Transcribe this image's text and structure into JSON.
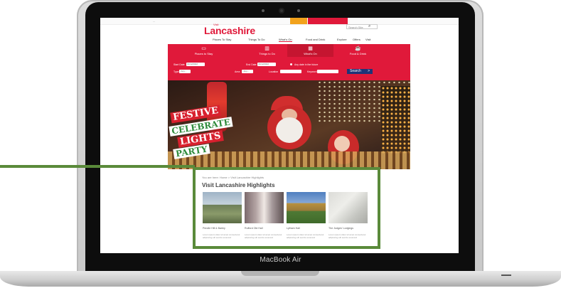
{
  "laptop": {
    "brand": "MacBook Air"
  },
  "site": {
    "logo_small": "Visit",
    "logo": "Lancashire",
    "search_placeholder": "Search Site",
    "topbar_text": "...",
    "nav": [
      "Places To Stay",
      "Things To Do",
      "What's On",
      "Food and Drink",
      "Explore",
      "Offers",
      "Visit"
    ],
    "active_nav": "What's On"
  },
  "search_panel": {
    "tabs": [
      {
        "label": "Places to Stay",
        "icon": "bed-icon"
      },
      {
        "label": "Things to Do",
        "icon": "ticket-icon"
      },
      {
        "label": "What's On",
        "icon": "calendar-icon"
      },
      {
        "label": "Food & Drink",
        "icon": "cup-icon"
      }
    ],
    "active_tab": "What's On",
    "start_date_label": "Start Date",
    "start_date_value": "01/12/2022",
    "end_date_label": "End Date",
    "end_date_value": "31/12/2022",
    "any_date_label": "Any date in the future",
    "type_label": "Type",
    "type_value": "- Any -",
    "area_label": "Area",
    "area_value": "- Any -",
    "location_label": "Location",
    "keyword_label": "Keyword",
    "search_button": "Search",
    "search_arrow": ">"
  },
  "hero": {
    "lines": [
      "FESTIVE",
      "CELEBRATE",
      "LIGHTS",
      "PARTY"
    ]
  },
  "highlights": {
    "breadcrumb": "You are here: Home > Visit Lancashire Highlights",
    "title": "Visit Lancashire Highlights",
    "cards": [
      {
        "title": "Pendle Hill & Barley",
        "desc": "Lorem ipsum dolor sit amet consectetur adipiscing elit sed do eiusmod"
      },
      {
        "title": "Rufford Old Hall",
        "desc": "Lorem ipsum dolor sit amet consectetur adipiscing elit sed do eiusmod"
      },
      {
        "title": "Lytham Hall",
        "desc": "Lorem ipsum dolor sit amet consectetur adipiscing elit sed do eiusmod"
      },
      {
        "title": "The Judges' Lodgings",
        "desc": "Lorem ipsum dolor sit amet consectetur adipiscing elit sed do eiusmod"
      }
    ]
  },
  "colors": {
    "brand_red": "#e0193a",
    "callout_green": "#5a8a3a",
    "button_navy": "#1f3478"
  }
}
